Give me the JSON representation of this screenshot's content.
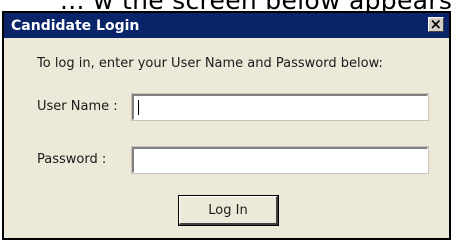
{
  "background_text": "... w the screen below appears,",
  "dialog": {
    "title": "Candidate Login",
    "close_icon": "close-x-icon",
    "instructions": "To log in, enter your User Name and Password below:",
    "user_name_label": "User Name :",
    "user_name_value": "",
    "password_label": "Password :",
    "password_value": "",
    "login_button_label": "Log In"
  },
  "colors": {
    "title_bar": "#0a246a",
    "dialog_background": "#ece9d8"
  }
}
